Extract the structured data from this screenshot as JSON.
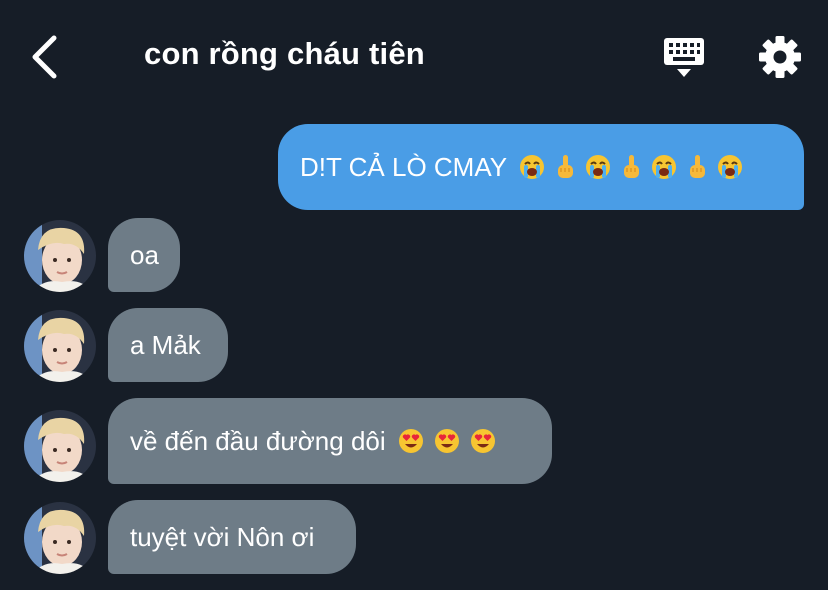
{
  "header": {
    "title": "con rồng cháu tiên",
    "back_icon": "chevron-left-icon",
    "keyboard_icon": "keyboard-icon",
    "settings_icon": "gear-icon"
  },
  "colors": {
    "background": "#161d27",
    "outgoing_bubble": "#4a9de6",
    "incoming_bubble": "#6e7c87",
    "text": "#ffffff"
  },
  "messages": [
    {
      "direction": "outgoing",
      "text": "D!T CẢ LÒ CMAY",
      "emojis": [
        "loudly-crying-face",
        "middle-finger",
        "loudly-crying-face",
        "middle-finger",
        "loudly-crying-face",
        "middle-finger",
        "loudly-crying-face"
      ]
    },
    {
      "direction": "incoming",
      "text": "oa",
      "emojis": []
    },
    {
      "direction": "incoming",
      "text": "a Mảk",
      "emojis": []
    },
    {
      "direction": "incoming",
      "text": "về đến đầu đường dôi",
      "emojis": [
        "heart-eyes-face",
        "heart-eyes-face",
        "heart-eyes-face"
      ]
    },
    {
      "direction": "incoming",
      "text": "tuyệt vời Nôn ơi",
      "emojis": []
    }
  ]
}
